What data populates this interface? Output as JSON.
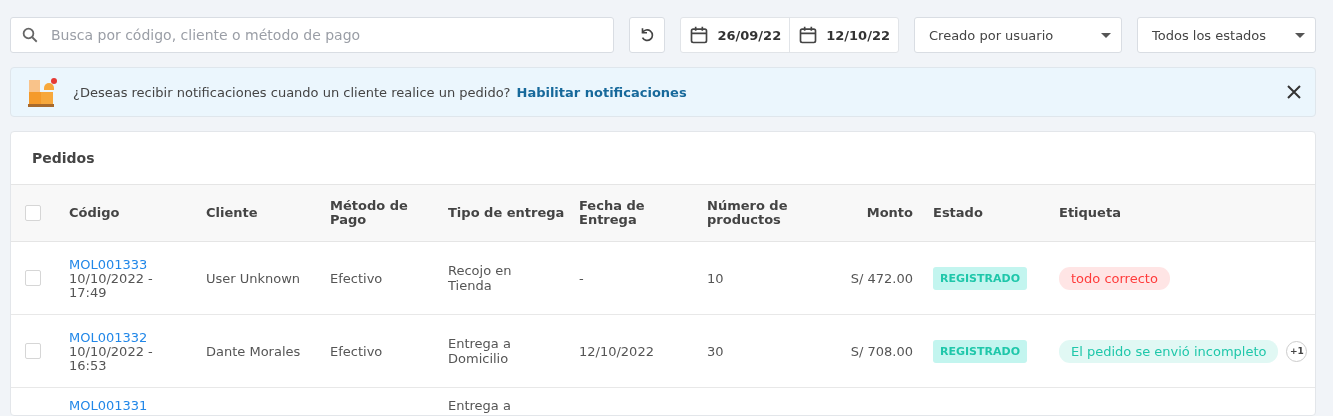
{
  "search": {
    "placeholder": "Busca por código, cliente o método de pago"
  },
  "date_range": {
    "start": "26/09/22",
    "end": "12/10/22"
  },
  "filters": [
    {
      "value": "Creado por usuario"
    },
    {
      "value": "Todos los estados"
    }
  ],
  "banner": {
    "message": "¿Deseas recibir notificaciones cuando un cliente realice un pedido?",
    "link": "Habilitar notificaciones"
  },
  "table": {
    "title": "Pedidos",
    "select_all_checked": false,
    "columns": [
      "Código",
      "Cliente",
      "Método de Pago",
      "Tipo de entrega",
      "Fecha de Entrega",
      "Número de productos",
      "Monto",
      "Estado",
      "Etiqueta"
    ],
    "rows": [
      {
        "checked": false,
        "code": "MOL001333",
        "date": "10/10/2022 - 17:49",
        "client": "User Unknown",
        "payment": "Efectivo",
        "delivery": "Recojo en Tienda",
        "delivery_date": "-",
        "products": "10",
        "amount": "S/ 472.00",
        "status": "REGISTRADO",
        "tags": [
          {
            "label": "todo correcto",
            "color": "#ff3b3b"
          }
        ]
      },
      {
        "checked": false,
        "code": "MOL001332",
        "date": "10/10/2022 - 16:53",
        "client": "Dante Morales",
        "payment": "Efectivo",
        "delivery": "Entrega a Domicilio",
        "delivery_date": "12/10/2022",
        "products": "30",
        "amount": "S/ 708.00",
        "status": "REGISTRADO",
        "tags": [
          {
            "label": "El pedido se envió incompleto",
            "color": "#1fc7aa"
          }
        ],
        "more_tags": "+1"
      },
      {
        "code": "MOL001331",
        "delivery": "Entrega a"
      }
    ]
  }
}
